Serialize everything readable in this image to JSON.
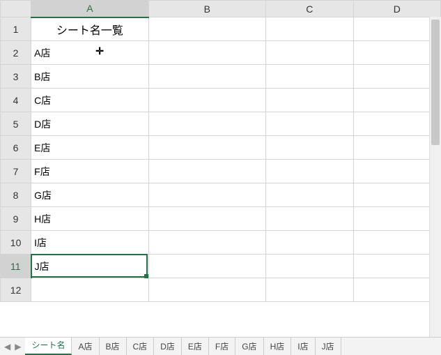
{
  "columns": [
    "A",
    "B",
    "C",
    "D"
  ],
  "rows": [
    "1",
    "2",
    "3",
    "4",
    "5",
    "6",
    "7",
    "8",
    "9",
    "10",
    "11",
    "12"
  ],
  "cells": {
    "A1": "シート名一覧",
    "A2": "A店",
    "A3": "B店",
    "A4": "C店",
    "A5": "D店",
    "A6": "E店",
    "A7": "F店",
    "A8": "G店",
    "A9": "H店",
    "A10": "I店",
    "A11": "J店"
  },
  "selected_cell": "A11",
  "cursor_cell": "A2",
  "tabs": {
    "active": "シート名",
    "items": [
      "シート名",
      "A店",
      "B店",
      "C店",
      "D店",
      "E店",
      "F店",
      "G店",
      "H店",
      "I店",
      "J店"
    ]
  },
  "nav": {
    "prev": "◀",
    "next": "▶"
  }
}
